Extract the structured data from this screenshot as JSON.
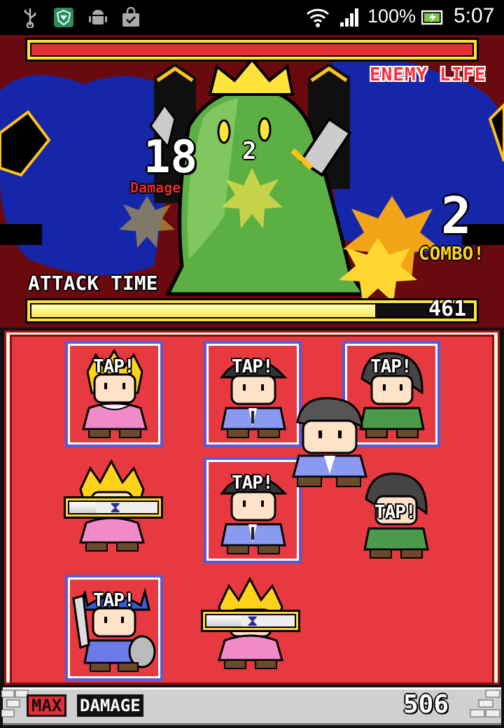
{
  "status_bar": {
    "battery_percent": "100%",
    "time": "5:07",
    "icons": [
      "usb-icon",
      "shield-app-icon",
      "android-icon",
      "shopping-bag-icon",
      "wifi-icon",
      "signal-icon",
      "battery-charging-icon"
    ]
  },
  "battle": {
    "enemy_life_label": "ENEMY LIFE",
    "enemy_life_fraction": 1.0,
    "damage_number": "18",
    "damage_label": "Damage",
    "hit_number": "2",
    "combo_number": "2",
    "combo_label": "COMBO!",
    "attack_time_label": "ATTACK TIME",
    "attack_time_fraction": 0.78,
    "attack_time_value": "461"
  },
  "party": {
    "tap_label": "TAP!",
    "members": [
      {
        "id": "slot-1",
        "character": "blonde-princess",
        "state": "tap"
      },
      {
        "id": "slot-2",
        "character": "capped-hero-blue",
        "state": "tap"
      },
      {
        "id": "slot-3",
        "character": "dark-hair-green",
        "state": "tap"
      },
      {
        "id": "slot-4",
        "character": "blonde-princess",
        "state": "cooldown",
        "cooldown_fraction": 0.3
      },
      {
        "id": "slot-5",
        "character": "capped-hero-blue",
        "state": "tap"
      },
      {
        "id": "slot-6",
        "character": "dark-hair-green",
        "state": "tap"
      },
      {
        "id": "slot-7",
        "character": "knight-with-shield",
        "state": "tap"
      },
      {
        "id": "slot-8",
        "character": "blonde-princess",
        "state": "cooldown",
        "cooldown_fraction": 0.4
      }
    ]
  },
  "bottom_bar": {
    "max_label": "MAX",
    "damage_label": "DAMAGE",
    "max_damage_value": "506"
  },
  "colors": {
    "enemy_life": "#e62c35",
    "bar_frame": "#ffe23a",
    "field": "#e73a40",
    "slot_border": "#5a5ad8",
    "combo": "#ffd21a"
  }
}
